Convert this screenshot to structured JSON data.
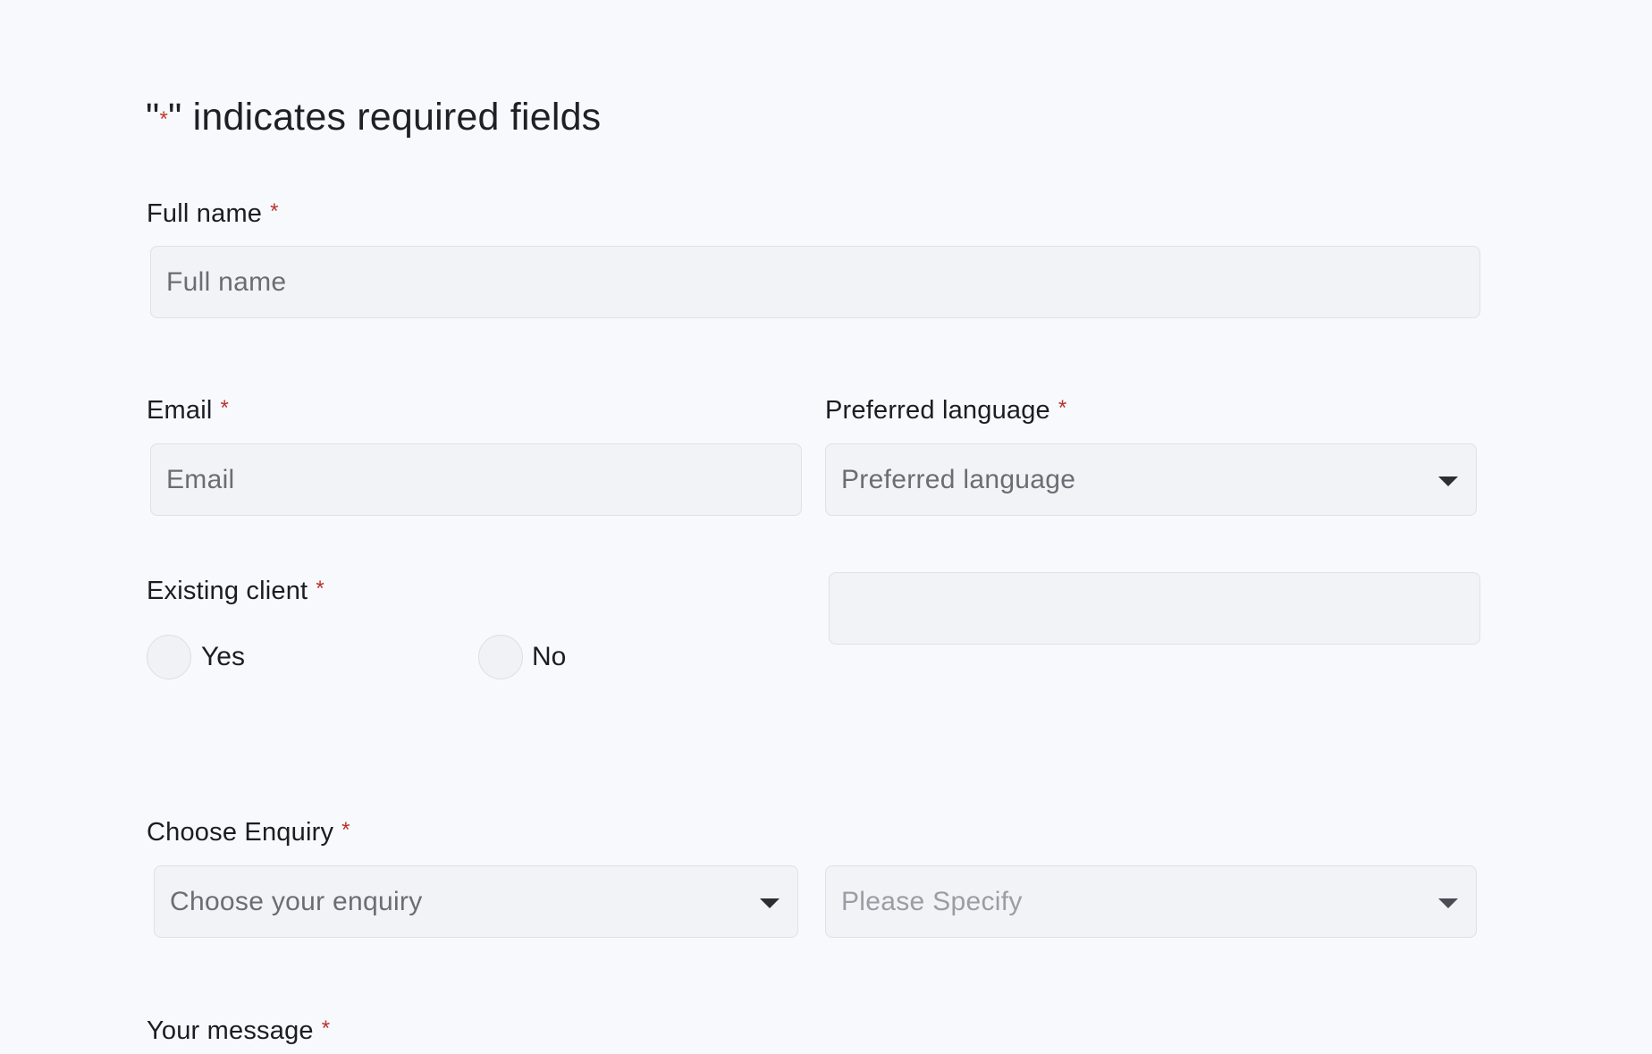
{
  "required_note": {
    "quote_open": "\"",
    "star": "*",
    "quote_close": "\"",
    "text": " indicates required fields"
  },
  "required_marker": "*",
  "full_name": {
    "label": "Full name",
    "placeholder": "Full name"
  },
  "email": {
    "label": "Email",
    "placeholder": "Email"
  },
  "preferred_language": {
    "label": "Preferred language",
    "placeholder": "Preferred language"
  },
  "existing_client": {
    "label": "Existing client",
    "options": [
      {
        "label": "Yes"
      },
      {
        "label": "No"
      }
    ]
  },
  "choose_enquiry": {
    "label": "Choose Enquiry",
    "placeholder": "Choose your enquiry"
  },
  "please_specify": {
    "placeholder": "Please Specify"
  },
  "your_message": {
    "label": "Your message"
  }
}
